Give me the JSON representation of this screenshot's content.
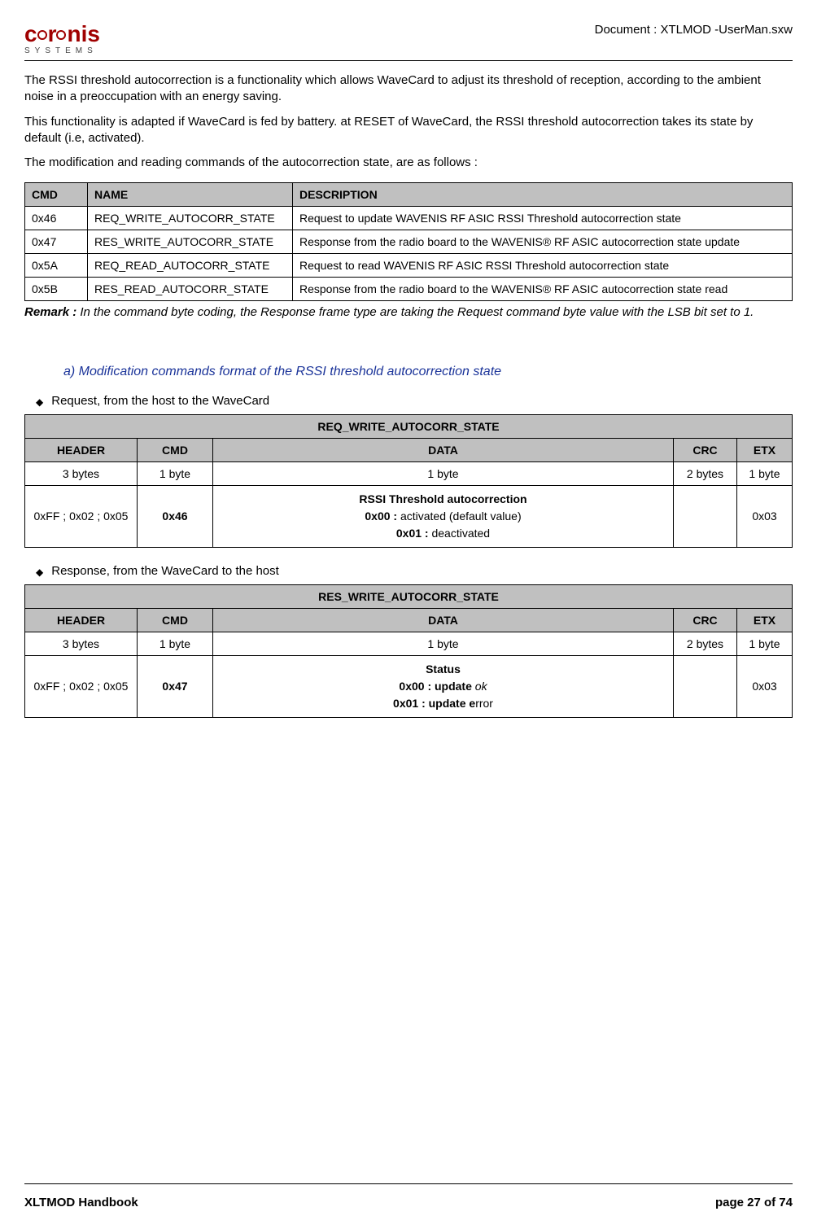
{
  "header": {
    "logo_main": "coronis",
    "logo_sub": "SYSTEMS",
    "doc_id": "Document : XTLMOD -UserMan.sxw"
  },
  "intro": {
    "p1": "The RSSI threshold autocorrection is a functionality which allows WaveCard to adjust its threshold of reception, according to the ambient noise in a preoccupation with an energy saving.",
    "p2": "This functionality is adapted if WaveCard is fed by battery. at RESET of WaveCard, the RSSI threshold autocorrection takes its state by default (i.e, activated).",
    "p3": "The modification and reading commands of the autocorrection state, are as follows :"
  },
  "cmd_table": {
    "headers": {
      "c0": "CMD",
      "c1": "NAME",
      "c2": "DESCRIPTION"
    },
    "rows": [
      {
        "cmd": "0x46",
        "name": "REQ_WRITE_AUTOCORR_STATE",
        "desc": "Request to update WAVENIS RF ASIC RSSI Threshold autocorrection state"
      },
      {
        "cmd": "0x47",
        "name": "RES_WRITE_AUTOCORR_STATE",
        "desc": "Response from the radio board to the WAVENIS® RF ASIC autocorrection state update"
      },
      {
        "cmd": "0x5A",
        "name": "REQ_READ_AUTOCORR_STATE",
        "desc": "Request to read WAVENIS RF ASIC RSSI Threshold autocorrection state"
      },
      {
        "cmd": "0x5B",
        "name": "RES_READ_AUTOCORR_STATE",
        "desc": "Response from the radio board to the WAVENIS® RF ASIC autocorrection state read"
      }
    ]
  },
  "remark": {
    "label": "Remark :",
    "text": "In the command byte coding, the Response frame type are taking the Request command byte value with the LSB bit set to 1."
  },
  "section_a": "a) Modification commands format of the RSSI threshold autocorrection state",
  "bullet1": "Request, from the host to the WaveCard",
  "bullet2": "Response, from the WaveCard to the host",
  "frame_headers": {
    "header": "HEADER",
    "cmd": "CMD",
    "data": "DATA",
    "crc": "CRC",
    "etx": "ETX"
  },
  "frame_sizes": {
    "header": "3 bytes",
    "cmd": "1 byte",
    "data": "1 byte",
    "crc": "2 bytes",
    "etx": "1 byte"
  },
  "req_frame": {
    "title": "REQ_WRITE_AUTOCORR_STATE",
    "header_val": "0xFF ; 0x02 ; 0x05",
    "cmd_val": "0x46",
    "data_title": "RSSI Threshold autocorrection",
    "data_l1a": "0x00 :",
    "data_l1b": " activated (default value)",
    "data_l2a": "0x01 :",
    "data_l2b": " deactivated",
    "crc_val": "",
    "etx_val": "0x03"
  },
  "res_frame": {
    "title": "RES_WRITE_AUTOCORR_STATE",
    "header_val": "0xFF ; 0x02 ; 0x05",
    "cmd_val": "0x47",
    "data_title": "Status",
    "data_l1a": "0x00 : update",
    "data_l1b": " ok",
    "data_l2a": "0x01 : update e",
    "data_l2b": "rror",
    "crc_val": "",
    "etx_val": "0x03"
  },
  "footer": {
    "left": "XLTMOD Handbook",
    "right": "page 27 of 74"
  }
}
